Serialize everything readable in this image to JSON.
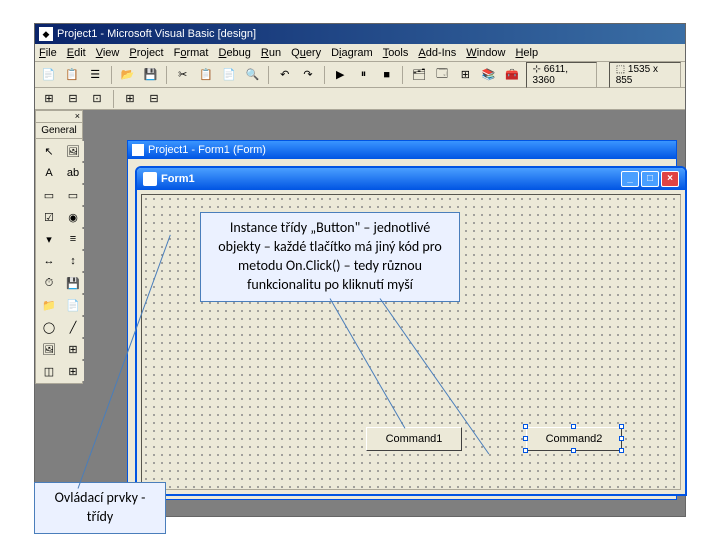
{
  "title": "Project1 - Microsoft Visual Basic [design]",
  "menus": [
    "File",
    "Edit",
    "View",
    "Project",
    "Format",
    "Debug",
    "Run",
    "Query",
    "Diagram",
    "Tools",
    "Add-Ins",
    "Window",
    "Help"
  ],
  "status": {
    "cursor": "6611, 3360",
    "size": "1535 x 855"
  },
  "toolbox": {
    "close": "×",
    "tab": "General"
  },
  "mdi": {
    "title": "Project1 - Form1 (Form)"
  },
  "form": {
    "title": "Form1",
    "buttons": [
      {
        "label": "Command1"
      },
      {
        "label": "Command2"
      }
    ]
  },
  "callouts": {
    "instance": "Instance třídy „Button\" – jednotlivé objekty – každé tlačítko má jiný kód pro metodu On.Click() – tedy různou funkcionalitu po kliknutí myší",
    "controls": "Ovládací prvky - třídy"
  },
  "icons": {
    "pointer": "↖",
    "label": "A",
    "picture": "🖼",
    "frame": "▭",
    "textbox": "ab",
    "check": "☑",
    "option": "◉",
    "combo": "▾",
    "list": "≡",
    "hscroll": "↔",
    "vscroll": "↕",
    "timer": "⏱",
    "drive": "💾",
    "dir": "📁",
    "file": "📄",
    "shape": "◯",
    "line": "╱",
    "image": "🖼",
    "data": "⊞",
    "ole": "◫"
  }
}
